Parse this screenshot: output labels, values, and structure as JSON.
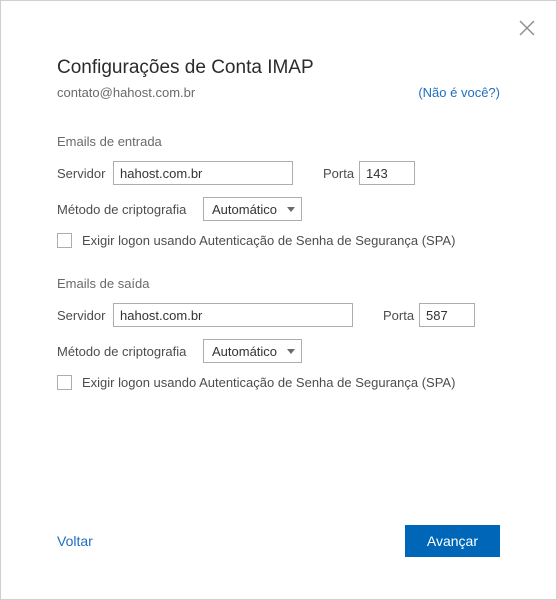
{
  "title": "Configurações de Conta IMAP",
  "email": "contato@hahost.com.br",
  "not_you_link": "(Não é você?)",
  "incoming": {
    "header": "Emails de entrada",
    "server_label": "Servidor",
    "server_value": "hahost.com.br",
    "port_label": "Porta",
    "port_value": "143",
    "method_label": "Método de criptografia",
    "method_value": "Automático",
    "spa_label": "Exigir logon usando Autenticação de Senha de Segurança (SPA)"
  },
  "outgoing": {
    "header": "Emails de saída",
    "server_label": "Servidor",
    "server_value": "hahost.com.br",
    "port_label": "Porta",
    "port_value": "587",
    "method_label": "Método de criptografia",
    "method_value": "Automático",
    "spa_label": "Exigir logon usando Autenticação de Senha de Segurança (SPA)"
  },
  "back_label": "Voltar",
  "next_label": "Avançar"
}
